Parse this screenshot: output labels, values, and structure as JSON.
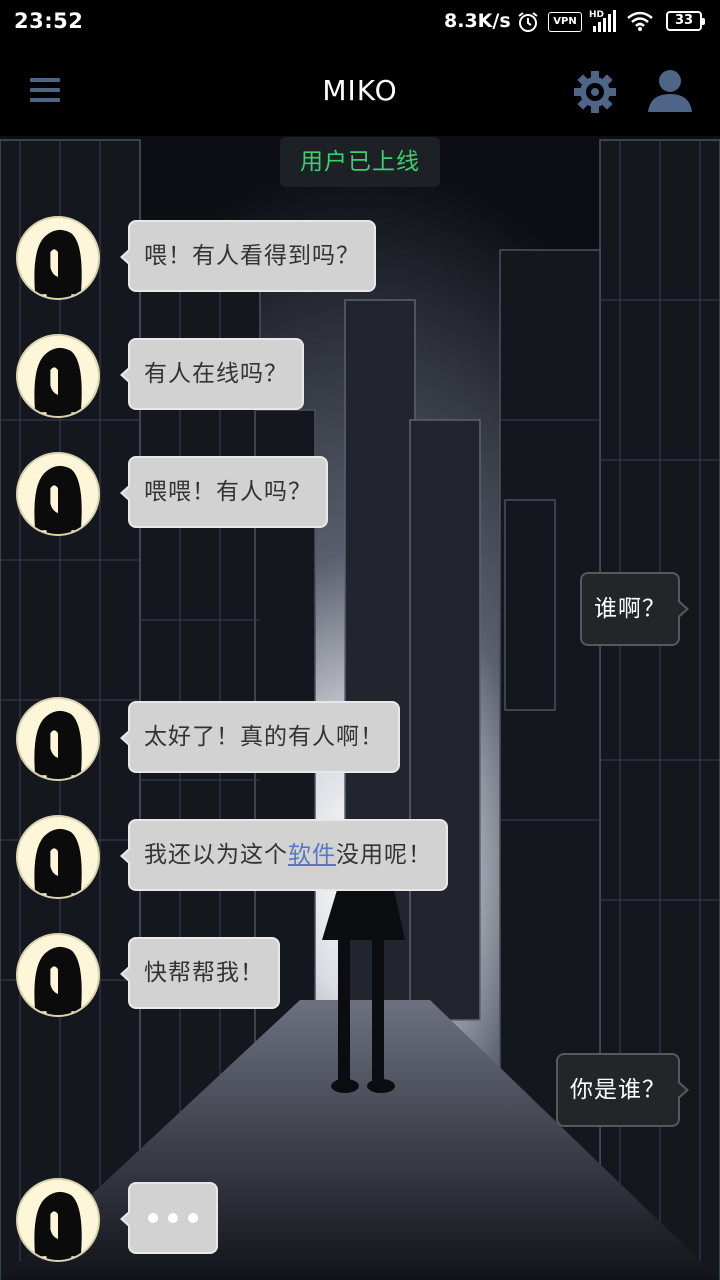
{
  "status_bar": {
    "time": "23:52",
    "net_speed": "8.3K/s",
    "vpn": "VPN",
    "battery": "33",
    "icons": [
      "alarm-icon",
      "vpn-icon",
      "hd-signal-icon",
      "wifi-icon",
      "battery-icon"
    ]
  },
  "header": {
    "title": "MIKO",
    "menu_icon": "hamburger-menu-icon",
    "settings_icon": "gear-icon",
    "profile_icon": "user-icon"
  },
  "toast": {
    "text": "用户已上线",
    "color": "#39d16b"
  },
  "messages": [
    {
      "sender": "miko",
      "text": "喂！有人看得到吗？"
    },
    {
      "sender": "miko",
      "text": "有人在线吗？"
    },
    {
      "sender": "miko",
      "text": "喂喂！有人吗？"
    },
    {
      "sender": "user",
      "text": "谁啊？"
    },
    {
      "sender": "miko",
      "text": "太好了！真的有人啊！"
    },
    {
      "sender": "miko",
      "text_before": "我还以为这个",
      "link": "软件",
      "text_after": "没用呢！"
    },
    {
      "sender": "miko",
      "text": "快帮帮我！"
    },
    {
      "sender": "user",
      "text": "你是谁？"
    },
    {
      "sender": "miko",
      "typing": true
    }
  ],
  "colors": {
    "incoming_bubble": "#d2d2d2",
    "outgoing_bubble": "#222628",
    "link": "#5677c4",
    "menu_accent": "#4f6588"
  }
}
